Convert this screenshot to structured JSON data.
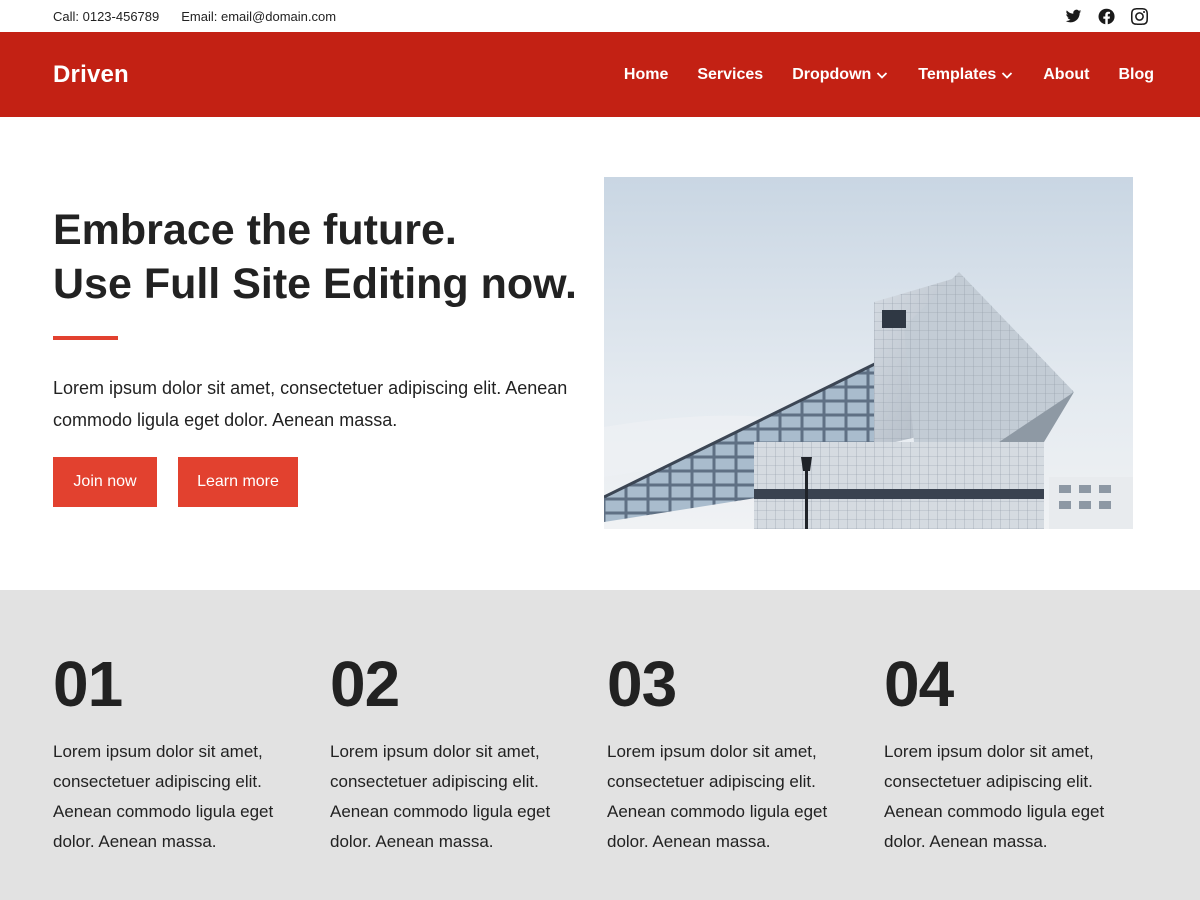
{
  "topbar": {
    "phone": "Call: 0123-456789",
    "email": "Email: email@domain.com",
    "social_icons": [
      "twitter-icon",
      "facebook-icon",
      "instagram-icon"
    ]
  },
  "header": {
    "logo": "Driven",
    "nav": [
      {
        "label": "Home",
        "dropdown": false
      },
      {
        "label": "Services",
        "dropdown": false
      },
      {
        "label": "Dropdown",
        "dropdown": true
      },
      {
        "label": "Templates",
        "dropdown": true
      },
      {
        "label": "About",
        "dropdown": false
      },
      {
        "label": "Blog",
        "dropdown": false
      }
    ]
  },
  "hero": {
    "title_line1": "Embrace the future.",
    "title_line2": "Use Full Site Editing now.",
    "text": "Lorem ipsum dolor sit amet, consectetuer adipiscing elit. Aenean commodo ligula eget dolor. Aenean massa.",
    "primary_button": "Join now",
    "secondary_button": "Learn more",
    "image": "modern-architecture-building-photo"
  },
  "features": [
    {
      "number": "01",
      "text": "Lorem ipsum dolor sit amet, consectetuer adipiscing elit. Aenean commodo ligula eget dolor. Aenean massa."
    },
    {
      "number": "02",
      "text": "Lorem ipsum dolor sit amet, consectetuer adipiscing elit. Aenean commodo ligula eget dolor. Aenean massa."
    },
    {
      "number": "03",
      "text": "Lorem ipsum dolor sit amet, consectetuer adipiscing elit. Aenean commodo ligula eget dolor. Aenean massa."
    },
    {
      "number": "04",
      "text": "Lorem ipsum dolor sit amet, consectetuer adipiscing elit. Aenean commodo ligula eget dolor. Aenean massa."
    }
  ],
  "colors": {
    "header_bg": "#c32114",
    "accent": "#e2412f",
    "features_bg": "#e2e2e2",
    "text": "#222222"
  }
}
